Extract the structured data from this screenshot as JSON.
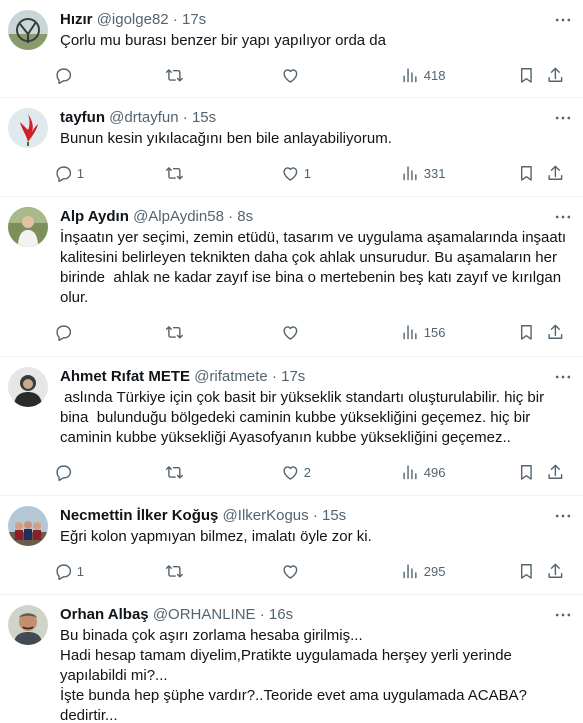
{
  "tweets": [
    {
      "name": "Hızır",
      "handle": "@igolge82",
      "time": "17s",
      "text": "Çorlu mu burası benzer bir yapı yapılıyor orda da",
      "replies": "",
      "retweets": "",
      "likes": "",
      "views": "418"
    },
    {
      "name": "tayfun",
      "handle": "@drtayfun",
      "time": "15s",
      "text": "Bunun kesin yıkılacağını ben bile anlayabiliyorum.",
      "replies": "1",
      "retweets": "",
      "likes": "1",
      "views": "331"
    },
    {
      "name": "Alp Aydın",
      "handle": "@AlpAydin58",
      "time": "8s",
      "text": "İnşaatın yer seçimi, zemin etüdü, tasarım ve uygulama aşamalarında inşaatı kalitesini belirleyen teknikten daha çok ahlak unsurudur. Bu aşamaların her birinde  ahlak ne kadar zayıf ise bina o mertebenin beş katı zayıf ve kırılgan olur.",
      "replies": "",
      "retweets": "",
      "likes": "",
      "views": "156"
    },
    {
      "name": "Ahmet Rıfat METE",
      "handle": "@rifatmete",
      "time": "17s",
      "text": " aslında Türkiye için çok basit bir yükseklik standartı oluşturulabilir. hiç bir bina  bulunduğu bölgedeki caminin kubbe yüksekliğini geçemez. hiç bir caminin kubbe yüksekliği Ayasofyanın kubbe yüksekliğini geçemez..",
      "replies": "",
      "retweets": "",
      "likes": "2",
      "views": "496"
    },
    {
      "name": "Necmettin İlker Koğuş",
      "handle": "@IlkerKogus",
      "time": "15s",
      "text": "Eğri kolon yapmıyan bilmez, imalatı öyle zor ki.",
      "replies": "1",
      "retweets": "",
      "likes": "",
      "views": "295"
    },
    {
      "name": "Orhan Albaş",
      "handle": "@ORHANLINE",
      "time": "16s",
      "text": "Bu binada çok aşırı zorlama hesaba girilmiş...\nHadi hesap tamam diyelim,Pratikte uygulamada herşey yerli yerinde yapılabildi mi?...\nİşte bunda hep şüphe vardır?..Teoride evet ama uygulamada ACABA? dedirtir...",
      "replies": "",
      "retweets": "",
      "likes": "",
      "views": ""
    }
  ],
  "meta": {
    "dot": "·"
  },
  "colors": {
    "text": "#0f1419",
    "secondary": "#536471",
    "divider": "#eff3f4"
  },
  "icons": [
    "reply-icon",
    "retweet-icon",
    "like-icon",
    "views-icon",
    "bookmark-icon",
    "share-icon",
    "more-icon"
  ]
}
